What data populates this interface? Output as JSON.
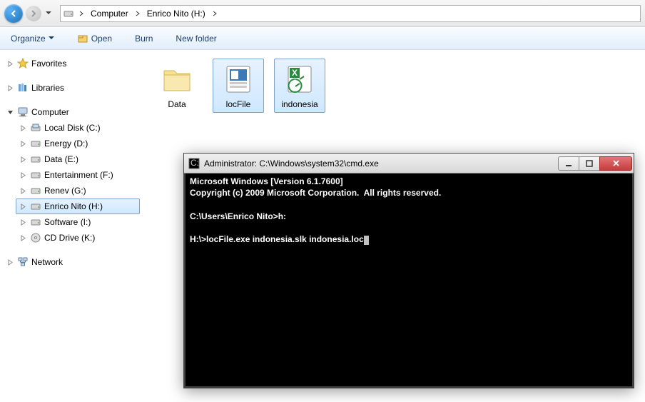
{
  "breadcrumb": {
    "parts": [
      "Computer",
      "Enrico Nito (H:)"
    ]
  },
  "toolbar": {
    "organize": "Organize",
    "open": "Open",
    "burn": "Burn",
    "new_folder": "New folder"
  },
  "tree": {
    "favorites": "Favorites",
    "libraries": "Libraries",
    "computer": "Computer",
    "drives": [
      "Local Disk (C:)",
      "Energy (D:)",
      "Data (E:)",
      "Entertainment (F:)",
      "Renev (G:)",
      "Enrico Nito (H:)",
      "Software (I:)",
      "CD Drive (K:)"
    ],
    "network": "Network"
  },
  "files": [
    {
      "name": "Data",
      "type": "folder"
    },
    {
      "name": "locFile",
      "type": "exe"
    },
    {
      "name": "indonesia",
      "type": "slk"
    }
  ],
  "cmd": {
    "title": "Administrator: C:\\Windows\\system32\\cmd.exe",
    "lines": [
      "Microsoft Windows [Version 6.1.7600]",
      "Copyright (c) 2009 Microsoft Corporation.  All rights reserved.",
      "",
      "C:\\Users\\Enrico Nito>h:",
      "",
      "H:\\>locFile.exe indonesia.slk indonesia.loc"
    ]
  }
}
